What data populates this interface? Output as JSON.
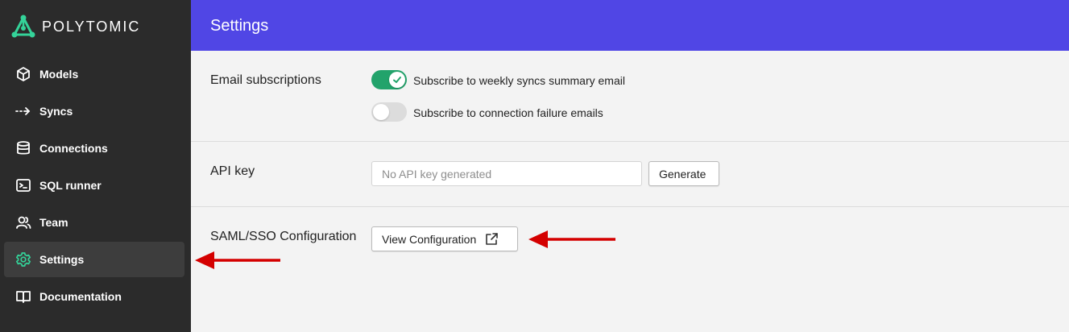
{
  "brand": {
    "name": "POLYTOMIC",
    "accent": "#34d399"
  },
  "sidebar": {
    "items": [
      {
        "label": "Models",
        "icon": "cube-icon",
        "active": false
      },
      {
        "label": "Syncs",
        "icon": "dashed-arrow-icon",
        "active": false
      },
      {
        "label": "Connections",
        "icon": "database-icon",
        "active": false
      },
      {
        "label": "SQL runner",
        "icon": "terminal-icon",
        "active": false
      },
      {
        "label": "Team",
        "icon": "users-icon",
        "active": false
      },
      {
        "label": "Settings",
        "icon": "gear-icon",
        "active": true
      },
      {
        "label": "Documentation",
        "icon": "book-icon",
        "active": false
      }
    ]
  },
  "header": {
    "title": "Settings",
    "color": "#5046e5"
  },
  "settings": {
    "email": {
      "label": "Email subscriptions",
      "options": [
        {
          "label": "Subscribe to weekly syncs summary email",
          "enabled": true
        },
        {
          "label": "Subscribe to connection failure emails",
          "enabled": false
        }
      ]
    },
    "api": {
      "label": "API key",
      "placeholder": "No API key generated",
      "value": "",
      "generate_label": "Generate"
    },
    "saml": {
      "label": "SAML/SSO Configuration",
      "button_label": "View Configuration",
      "button_icon": "external-link-icon"
    }
  },
  "annotations": {
    "arrow_color": "#d40000"
  }
}
